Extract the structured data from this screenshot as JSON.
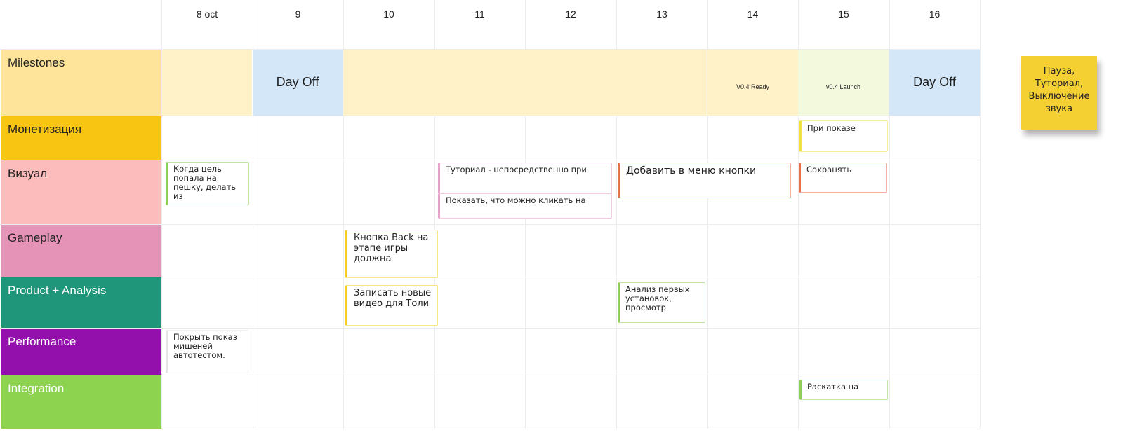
{
  "days": [
    "8 oct",
    "9",
    "10",
    "11",
    "12",
    "13",
    "14",
    "15",
    "16"
  ],
  "lanes": [
    {
      "label": "Milestones",
      "color": "#fde49a"
    },
    {
      "label": "Монетизация",
      "color": "#f8c513"
    },
    {
      "label": "Визуал",
      "color": "#fdbcbc"
    },
    {
      "label": "Gameplay",
      "color": "#e693b8"
    },
    {
      "label": "Product + Analysis",
      "color": "#1f957a"
    },
    {
      "label": "Performance",
      "color": "#9410ac"
    },
    {
      "label": "Integration",
      "color": "#8dd350"
    }
  ],
  "milestones": {
    "day_off_1": "Day Off",
    "v04_ready": "V0.4 Ready",
    "v04_launch": "v0.4 Launch",
    "day_off_2": "Day Off"
  },
  "cards": [
    {
      "text": "Когда цель попала на пешку, делать из",
      "accent": "#8cd05a"
    },
    {
      "text": "Туториал - непосредственно при",
      "accent": "#e8a0c8"
    },
    {
      "text": "Показать, что можно кликать на",
      "accent": "#e8a0c8"
    },
    {
      "text": "Добавить в меню кнопки",
      "accent": "#e8704a"
    },
    {
      "text": "Сохранять",
      "accent": "#e8704a"
    },
    {
      "text": "При показе",
      "accent": "#f0e040"
    },
    {
      "text": "Кнопка Back на этапе игры должна",
      "accent": "#f5d020"
    },
    {
      "text": "Записать новые видео для Толи",
      "accent": "#f5d020"
    },
    {
      "text": "Анализ первых установок, просмотр",
      "accent": "#8cd05a"
    },
    {
      "text": "Покрыть показ мишеней автотестом.",
      "accent": "#e4e4e4"
    },
    {
      "text": "Раскатка на",
      "accent": "#8cd05a"
    }
  ],
  "sticky_note": {
    "text": "Пауза, Туториал, Выключение звука",
    "color": "#f5d033"
  }
}
